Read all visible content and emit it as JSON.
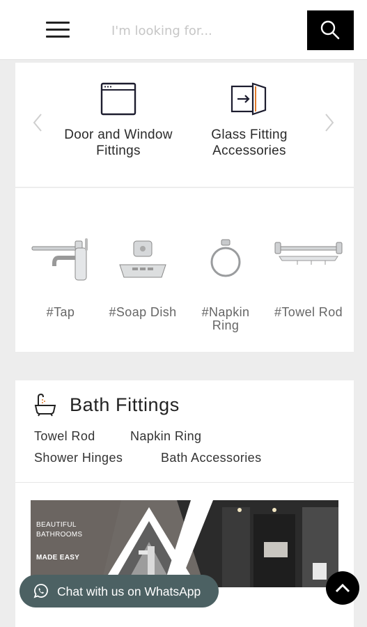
{
  "header": {
    "search_placeholder": "I'm looking for...",
    "search_icon": "search-icon",
    "menu_icon": "hamburger-menu-icon"
  },
  "categories": [
    {
      "label": "Door and Window Fittings",
      "icon": "browser-window-icon"
    },
    {
      "label": "Glass Fitting Accessories",
      "icon": "door-enter-icon"
    }
  ],
  "tags": [
    {
      "label": "#Tap"
    },
    {
      "label": "#Soap Dish"
    },
    {
      "label": "#Napkin Ring"
    },
    {
      "label": "#Towel Rod"
    }
  ],
  "bath": {
    "title": "Bath Fittings",
    "icon": "bathtub-icon",
    "links": [
      "Towel Rod",
      "Napkin Ring",
      "Shower Hinges",
      "Bath Accessories"
    ],
    "banner": {
      "line1": "BEAUTIFUL",
      "line2": "BATHROOMS",
      "line3": "MADE EASY"
    }
  },
  "whatsapp": {
    "label": "Chat with us on WhatsApp",
    "icon": "whatsapp-icon"
  },
  "scroll_top_icon": "chevron-up-icon",
  "colors": {
    "accent": "#000000",
    "whatsapp_bg": "#4c6163",
    "background": "#ededed"
  }
}
